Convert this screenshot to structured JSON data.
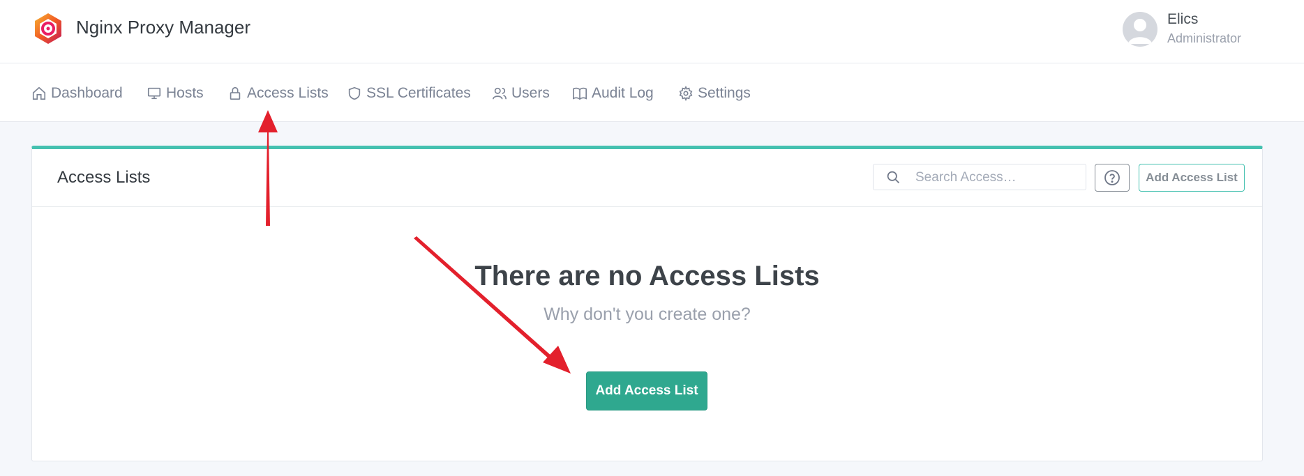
{
  "app": {
    "title": "Nginx Proxy Manager"
  },
  "user": {
    "name": "Elics",
    "role": "Administrator"
  },
  "nav": {
    "items": [
      {
        "label": "Dashboard",
        "icon": "home-icon"
      },
      {
        "label": "Hosts",
        "icon": "monitor-icon"
      },
      {
        "label": "Access Lists",
        "icon": "lock-icon"
      },
      {
        "label": "SSL Certificates",
        "icon": "shield-icon"
      },
      {
        "label": "Users",
        "icon": "users-icon"
      },
      {
        "label": "Audit Log",
        "icon": "book-icon"
      },
      {
        "label": "Settings",
        "icon": "gear-icon"
      }
    ]
  },
  "card": {
    "title": "Access Lists",
    "search_placeholder": "Search Access…",
    "add_button_label": "Add Access List",
    "empty_title": "There are no Access Lists",
    "empty_subtitle": "Why don't you create one?",
    "primary_button_label": "Add Access List"
  },
  "colors": {
    "accent": "#45c1b0",
    "primary_button": "#2fa88f",
    "annotation_arrow": "#e3202c"
  }
}
